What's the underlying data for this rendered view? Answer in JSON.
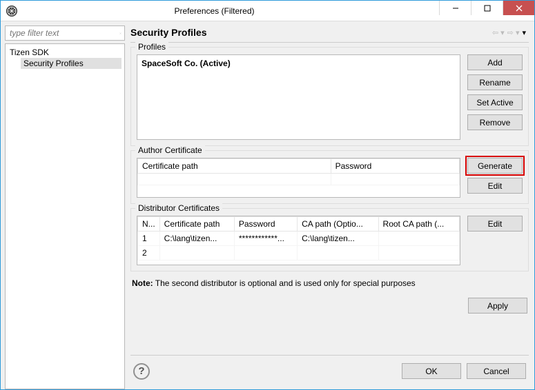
{
  "window": {
    "title": "Preferences (Filtered)"
  },
  "filter": {
    "placeholder": "type filter text"
  },
  "tree": {
    "root": "Tizen SDK",
    "child": "Security Profiles"
  },
  "header": {
    "title": "Security Profiles"
  },
  "profiles_group": {
    "label": "Profiles",
    "entry": "SpaceSoft Co. (Active)",
    "buttons": {
      "add": "Add",
      "rename": "Rename",
      "set_active": "Set Active",
      "remove": "Remove"
    }
  },
  "author_group": {
    "label": "Author Certificate",
    "columns": {
      "cert_path": "Certificate path",
      "password": "Password"
    },
    "buttons": {
      "generate": "Generate",
      "edit": "Edit"
    }
  },
  "dist_group": {
    "label": "Distributor Certificates",
    "columns": {
      "num": "N...",
      "cert_path": "Certificate path",
      "password": "Password",
      "ca_path": "CA path (Optio...",
      "root_ca": "Root CA path (..."
    },
    "rows": [
      {
        "num": "1",
        "cert_path": "C:\\lang\\tizen...",
        "password": "************...",
        "ca_path": "C:\\lang\\tizen...",
        "root_ca": ""
      },
      {
        "num": "2",
        "cert_path": "",
        "password": "",
        "ca_path": "",
        "root_ca": ""
      }
    ],
    "buttons": {
      "edit": "Edit"
    }
  },
  "note": {
    "label": "Note:",
    "text": " The second distributor is optional and is used only for special purposes"
  },
  "buttons": {
    "apply": "Apply",
    "ok": "OK",
    "cancel": "Cancel"
  }
}
